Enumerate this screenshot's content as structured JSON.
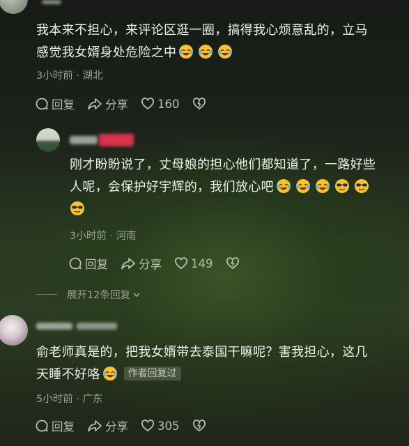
{
  "comments": [
    {
      "text_line1": "我本来不担心，来评论区逛一圈，搞得我心烦意乱的，立马",
      "text_line2": "感觉我女婿身处危险之中",
      "meta": "3小时前 · 湖北",
      "reply_label": "回复",
      "share_label": "分享",
      "like_count": "160"
    },
    {
      "text_line1": "刚才盼盼说了，丈母娘的担心他们都知道了，一路好些",
      "text_line2": "人呢，会保护好宇辉的，我们放心吧",
      "meta": "3小时前 · 河南",
      "reply_label": "回复",
      "share_label": "分享",
      "like_count": "149"
    },
    {
      "text_line1": "俞老师真是的，把我女婿带去泰国干嘛呢？害我担心，这几",
      "text_line2": "天睡不好咯",
      "badge": "作者回复过",
      "meta": "5小时前 · 广东",
      "reply_label": "回复",
      "share_label": "分享",
      "like_count": "305"
    }
  ],
  "expand_label": "展开12条回复",
  "icons": [
    "reply-icon",
    "share-icon",
    "heart-icon",
    "dislike-heart-icon",
    "laughing-tears-emoji",
    "sunglasses-emoji",
    "chevron-down-icon"
  ]
}
